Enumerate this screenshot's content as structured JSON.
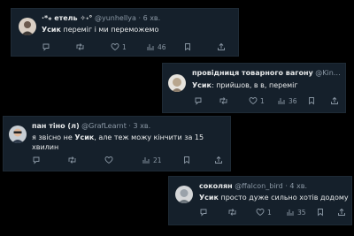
{
  "tweets": [
    {
      "name": "·*⁎ етель ✧˖°",
      "handle": "@yunhellya",
      "time": "6 хв.",
      "text_bold": "Усик",
      "text_rest": " переміг і ми переможемо",
      "text_line2": "",
      "retweets": "",
      "likes": "1",
      "views": "46"
    },
    {
      "name": "провідниця товарного вагону",
      "handle": "@Kin…",
      "time": "",
      "text_bold": "Усик",
      "text_rest": ": прийшов, в    в, переміг",
      "text_line2": "",
      "retweets": "",
      "likes": "1",
      "views": "36"
    },
    {
      "name": "пан тіно (л)",
      "handle": "@GrafLearnt",
      "time": "3 хв.",
      "text_pre": "я звісно не ",
      "text_bold": "Усик",
      "text_rest": ", але теж можу кінчити за 15",
      "text_line2": "хвилин",
      "retweets": "",
      "likes": "",
      "views": "21"
    },
    {
      "name": "соколян",
      "handle": "@ffalcon_bird",
      "time": "4 хв.",
      "text_bold": "Усик",
      "text_rest": " просто дуже сильно хотів додому",
      "text_line2": "",
      "retweets": "",
      "likes": "1",
      "views": "35"
    }
  ],
  "separator": "·",
  "icons": [
    "reply-icon",
    "retweet-icon",
    "like-icon",
    "views-icon",
    "share-icon"
  ]
}
